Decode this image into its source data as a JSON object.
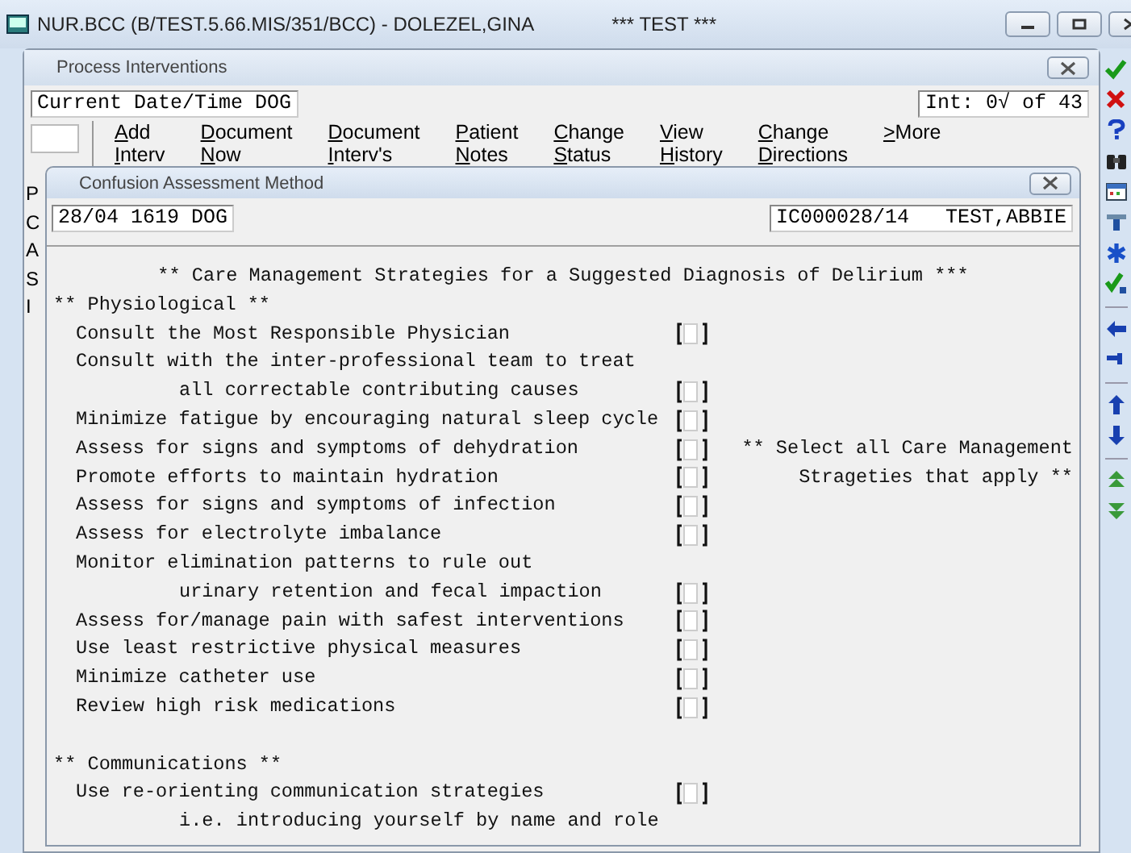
{
  "window": {
    "title": "NUR.BCC (B/TEST.5.66.MIS/351/BCC) - DOLEZEL,GINA",
    "environment": "*** TEST ***"
  },
  "process_window": {
    "title": "Process Interventions",
    "current_field": "Current Date/Time DOG",
    "counter_field": "Int: 0√ of 43",
    "menu": [
      {
        "lines": [
          "Add",
          "Interv"
        ]
      },
      {
        "lines": [
          "Document",
          "Now"
        ]
      },
      {
        "lines": [
          "Document",
          "Interv's"
        ]
      },
      {
        "lines": [
          "Patient",
          "Notes"
        ]
      },
      {
        "lines": [
          "Change",
          "Status"
        ]
      },
      {
        "lines": [
          "View",
          "History"
        ]
      },
      {
        "lines": [
          "Change",
          "Directions"
        ]
      },
      {
        "lines": [
          ">More"
        ]
      }
    ],
    "row_labels": [
      "P",
      "C",
      "A",
      "S",
      "I"
    ]
  },
  "dialog": {
    "title": "Confusion Assessment Method",
    "date_field": "28/04 1619 DOG",
    "patient_field": "IC000028/14   TEST,ABBIE",
    "heading": "** Care Management Strategies for a Suggested Diagnosis of Delirium ***",
    "sections": [
      {
        "title": "** Physiological **",
        "rows": [
          {
            "kind": "check",
            "text": "Consult the Most Responsible Physician",
            "checked": false
          },
          {
            "kind": "line",
            "text": "Consult with the inter-professional team to treat"
          },
          {
            "kind": "wrap_check",
            "text": "all correctable contributing causes",
            "checked": false
          },
          {
            "kind": "check",
            "text": "Minimize fatigue by encouraging natural sleep cycle",
            "checked": false
          },
          {
            "kind": "check",
            "text": "Assess for signs and symptoms of dehydration",
            "checked": false,
            "side_note": "** Select all Care Management"
          },
          {
            "kind": "check",
            "text": "Promote efforts to maintain hydration",
            "checked": false,
            "side_note": "Strageties that apply **"
          },
          {
            "kind": "check",
            "text": "Assess for signs and symptoms of infection",
            "checked": false
          },
          {
            "kind": "check",
            "text": "Assess for electrolyte imbalance",
            "checked": false
          },
          {
            "kind": "line",
            "text": "Monitor elimination patterns to rule out"
          },
          {
            "kind": "wrap_check",
            "text": "urinary retention and fecal impaction",
            "checked": false
          },
          {
            "kind": "check",
            "text": "Assess for/manage pain with safest interventions",
            "checked": false
          },
          {
            "kind": "check",
            "text": "Use least restrictive physical measures",
            "checked": false
          },
          {
            "kind": "check",
            "text": "Minimize catheter use",
            "checked": false
          },
          {
            "kind": "check",
            "text": "Review high risk medications",
            "checked": false
          }
        ]
      },
      {
        "title": "** Communications **",
        "rows": [
          {
            "kind": "check",
            "text": "Use re-orienting communication strategies",
            "checked": false
          },
          {
            "kind": "wrap",
            "text": "i.e. introducing yourself by name and role"
          }
        ]
      }
    ]
  }
}
